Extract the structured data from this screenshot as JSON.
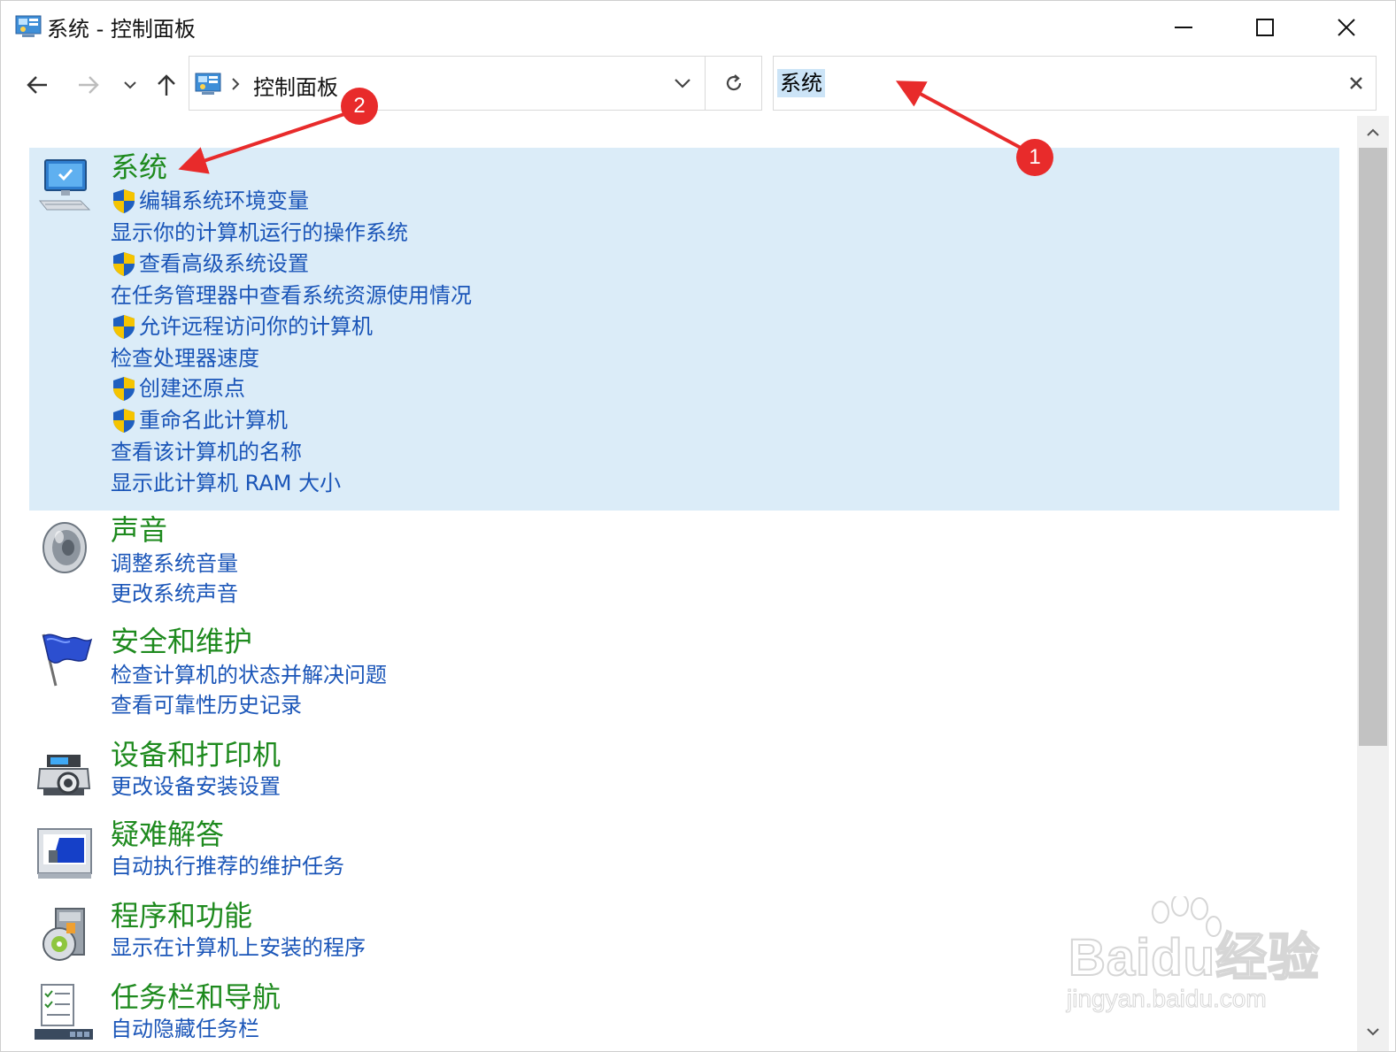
{
  "window": {
    "title": "系统 - 控制面板"
  },
  "address": {
    "location": "控制面板"
  },
  "search": {
    "value": "系统"
  },
  "results": [
    {
      "title": "系统",
      "icon": "computer-monitor-icon",
      "links": [
        {
          "label": "编辑系统环境变量",
          "shield": true
        },
        {
          "label": "显示你的计算机运行的操作系统",
          "shield": false
        },
        {
          "label": "查看高级系统设置",
          "shield": true
        },
        {
          "label": "在任务管理器中查看系统资源使用情况",
          "shield": false
        },
        {
          "label": "允许远程访问你的计算机",
          "shield": true
        },
        {
          "label": "检查处理器速度",
          "shield": false
        },
        {
          "label": "创建还原点",
          "shield": true
        },
        {
          "label": "重命名此计算机",
          "shield": true
        },
        {
          "label": "查看该计算机的名称",
          "shield": false
        },
        {
          "label": "显示此计算机 RAM 大小",
          "shield": false
        }
      ]
    },
    {
      "title": "声音",
      "icon": "speaker-icon",
      "links": [
        {
          "label": "调整系统音量",
          "shield": false
        },
        {
          "label": "更改系统声音",
          "shield": false
        }
      ]
    },
    {
      "title": "安全和维护",
      "icon": "flag-icon",
      "links": [
        {
          "label": "检查计算机的状态并解决问题",
          "shield": false
        },
        {
          "label": "查看可靠性历史记录",
          "shield": false
        }
      ]
    },
    {
      "title": "设备和打印机",
      "icon": "printer-camera-icon",
      "links": [
        {
          "label": "更改设备安装设置",
          "shield": false
        }
      ]
    },
    {
      "title": "疑难解答",
      "icon": "troubleshoot-monitor-icon",
      "links": [
        {
          "label": "自动执行推荐的维护任务",
          "shield": false
        }
      ]
    },
    {
      "title": "程序和功能",
      "icon": "programs-disc-icon",
      "links": [
        {
          "label": "显示在计算机上安装的程序",
          "shield": false
        }
      ]
    },
    {
      "title": "任务栏和导航",
      "icon": "taskbar-checklist-icon",
      "links": [
        {
          "label": "自动隐藏任务栏",
          "shield": false
        }
      ]
    }
  ],
  "annotations": {
    "badge_1": "1",
    "badge_2": "2",
    "color": "#e82b2b"
  },
  "watermark": {
    "brand": "Baidu经验",
    "url": "jingyan.baidu.com"
  },
  "colors": {
    "title_green": "#1e8a1e",
    "link_blue": "#1a55b8",
    "selection": "#dbecf8",
    "search_highlight": "#cce4f7"
  }
}
